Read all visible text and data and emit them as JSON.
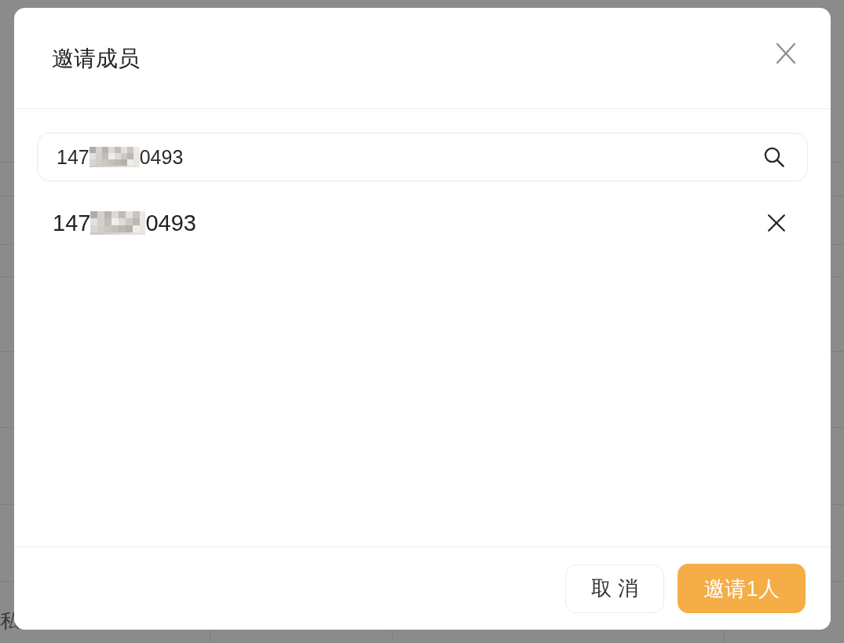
{
  "background_table": {
    "cell": "私"
  },
  "dialog": {
    "title": "邀请成员",
    "search": {
      "value_start": "147",
      "value_end": "0493"
    },
    "results": [
      {
        "number_start": "147",
        "number_end": "0493"
      }
    ],
    "buttons": [
      {
        "label": "取 消",
        "kind": "secondary"
      },
      {
        "label": "邀请1人",
        "kind": "primary"
      }
    ]
  }
}
